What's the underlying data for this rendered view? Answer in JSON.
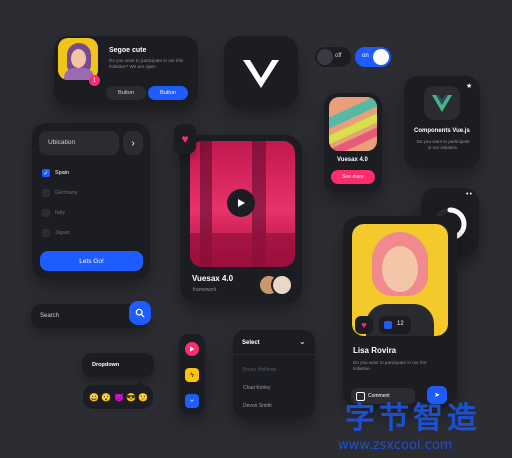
{
  "profile_card": {
    "name": "Segoe cute",
    "message": "Do you want to participate in our this initiative? We are open",
    "badge": "1",
    "button1": "Button",
    "button2": "Button"
  },
  "toggles": {
    "off_label": "off",
    "on_label": "on"
  },
  "location_card": {
    "select_label": "Ubication",
    "options": [
      "Spain",
      "Germany",
      "Italy",
      "Japan"
    ],
    "checked_index": 0,
    "cta": "Lets Go!"
  },
  "media_card": {
    "title": "Vuesax 4.0",
    "subtitle": "framework"
  },
  "mini_card": {
    "title": "Vuesax 4.0",
    "button": "See more"
  },
  "components_card": {
    "title": "Components Vue.js",
    "description": "Do you want to participate in our initiative."
  },
  "progress_ring": {
    "percent": 80
  },
  "search": {
    "placeholder": "Search"
  },
  "dropdown": {
    "label": "Dropdown",
    "emojis": [
      "😀",
      "😯",
      "😈",
      "😎",
      "🙂"
    ]
  },
  "select_menu": {
    "label": "Select",
    "options": [
      "Bruno Hoffman",
      "Chad Korley",
      "Devon Smith"
    ]
  },
  "user_card": {
    "name": "Lisa Rovira",
    "message": "Do you want to participate in our the initiative.",
    "like_count": "12",
    "comment_label": "Comment"
  },
  "watermark": {
    "cn_text": "字节智造",
    "url": "www.zsxcool.com"
  },
  "colors": {
    "background": "#2c2d32",
    "card": "#1c1d22",
    "primary": "#1f5cff",
    "accent_pink": "#ff2c6c",
    "accent_yellow": "#ffc107",
    "vue_green": "#41b883"
  }
}
